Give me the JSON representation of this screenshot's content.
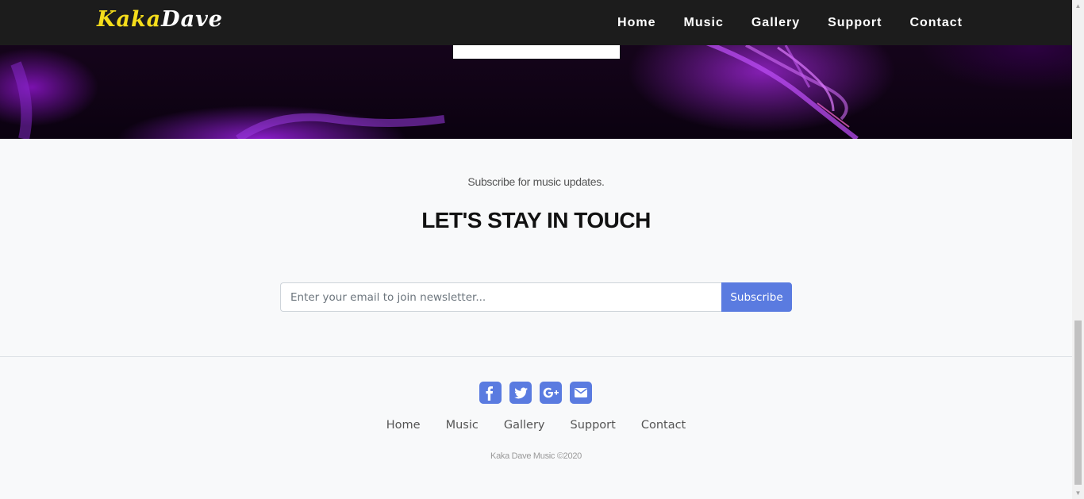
{
  "brand": {
    "part1": "Kaka",
    "part2": "Dave",
    "color1": "#f5dd1b",
    "color2": "#ffffff"
  },
  "nav": {
    "items": [
      "Home",
      "Music",
      "Gallery",
      "Support",
      "Contact"
    ]
  },
  "newsletter": {
    "subtitle": "Subscribe for music updates.",
    "title": "LET'S STAY IN TOUCH",
    "placeholder": "Enter your email to join newsletter...",
    "button_label": "Subscribe"
  },
  "footer": {
    "social_icons": [
      "facebook-icon",
      "twitter-icon",
      "google-plus-icon",
      "envelope-icon"
    ],
    "links": [
      "Home",
      "Music",
      "Gallery",
      "Support",
      "Contact"
    ],
    "copyright": "Kaka Dave Music ©2020"
  },
  "colors": {
    "accent": "#5a7be0",
    "navbar": "#1c1c1c",
    "background": "#f8f9fa"
  }
}
